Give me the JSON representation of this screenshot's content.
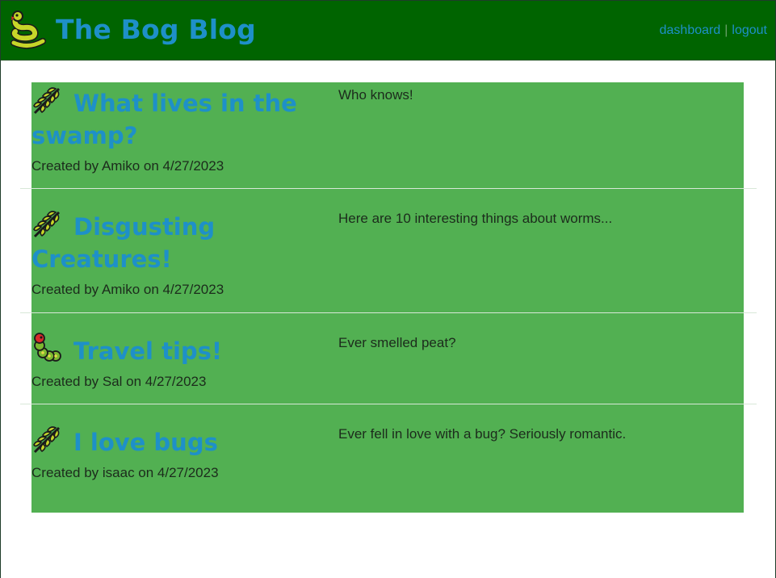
{
  "header": {
    "title": "The Bog Blog",
    "logo_icon": "snake-icon",
    "nav": {
      "dashboard": "dashboard",
      "separator": "|",
      "logout": "logout"
    }
  },
  "colors": {
    "header_bg": "#006400",
    "link": "#1e90c8",
    "panel_bg": "#52b052"
  },
  "posts": [
    {
      "title": "What lives in the swamp?",
      "icon": "leaf-icon",
      "meta": "Created by Amiko on 4/27/2023",
      "body": "Who knows!"
    },
    {
      "title": "Disgusting Creatures!",
      "icon": "leaf-icon",
      "meta": "Created by Amiko on 4/27/2023",
      "body": "Here are 10 interesting things about worms..."
    },
    {
      "title": "Travel tips!",
      "icon": "caterpillar-icon",
      "meta": "Created by Sal on 4/27/2023",
      "body": "Ever smelled peat?"
    },
    {
      "title": "I love bugs",
      "icon": "leaf-icon",
      "meta": "Created by isaac on 4/27/2023",
      "body": "Ever fell in love with a bug? Seriously romantic."
    }
  ]
}
